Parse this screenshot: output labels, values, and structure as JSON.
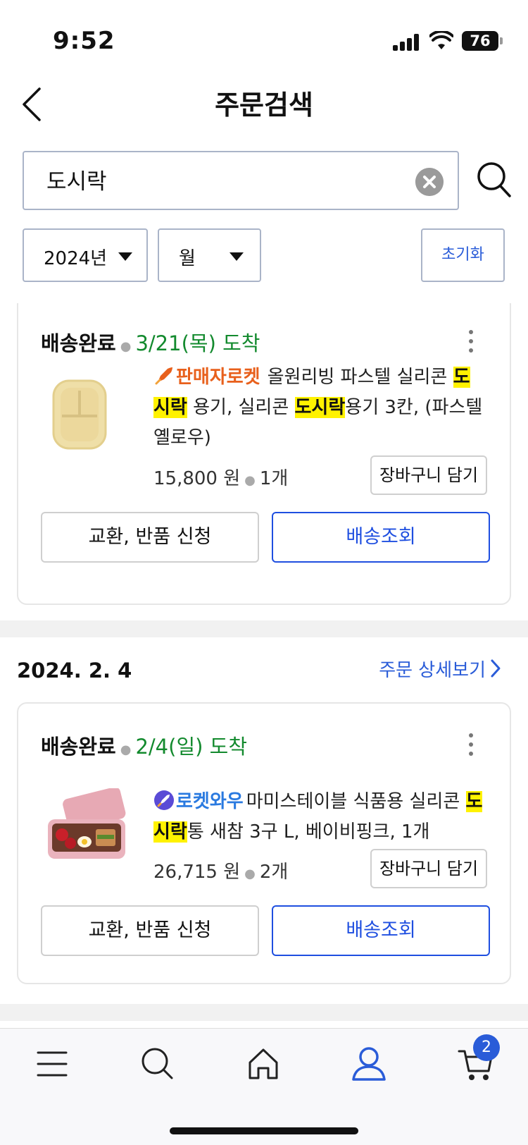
{
  "status_bar": {
    "time": "9:52",
    "battery": "76"
  },
  "header": {
    "title": "주문검색"
  },
  "search": {
    "value": "도시락"
  },
  "filters": {
    "year": "2024년",
    "month": "월",
    "reset": "초기화"
  },
  "orders": [
    {
      "status": "배송완료",
      "arrival": "3/21(목) 도착",
      "badge": "판매자로켓",
      "name_pre": "올원리빙 파스텔 실리콘 ",
      "name_hl1": "도시락",
      "name_mid": " 용기, 실리콘 ",
      "name_hl2": "도시락",
      "name_post": "용기 3칸, (파스텔옐로우)",
      "price": "15,800 원",
      "qty": "1개",
      "cart_label": "장바구니 담기",
      "return_label": "교환, 반품 신청",
      "track_label": "배송조회"
    },
    {
      "date": "2024. 2. 4",
      "detail_label": "주문 상세보기",
      "status": "배송완료",
      "arrival": "2/4(일) 도착",
      "badge": "로켓와우",
      "name_pre": "마미스테이블 식품용 실리콘 ",
      "name_hl1": "도시락",
      "name_post": "통 새참 3구 L, 베이비핑크, 1개",
      "price": "26,715 원",
      "qty": "2개",
      "cart_label": "장바구니 담기",
      "return_label": "교환, 반품 신청",
      "track_label": "배송조회"
    }
  ],
  "bottom_nav": {
    "cart_count": "2"
  },
  "colors": {
    "accent": "#2a5cd8",
    "status_green": "#138a2e",
    "highlight": "#fff200",
    "seller_orange": "#e8601c"
  },
  "icons": [
    "back-arrow-icon",
    "clear-icon",
    "search-icon",
    "caret-down-icon",
    "more-vertical-icon",
    "rocket-icon",
    "chevron-right-icon",
    "menu-icon",
    "home-icon",
    "user-icon",
    "cart-icon"
  ]
}
